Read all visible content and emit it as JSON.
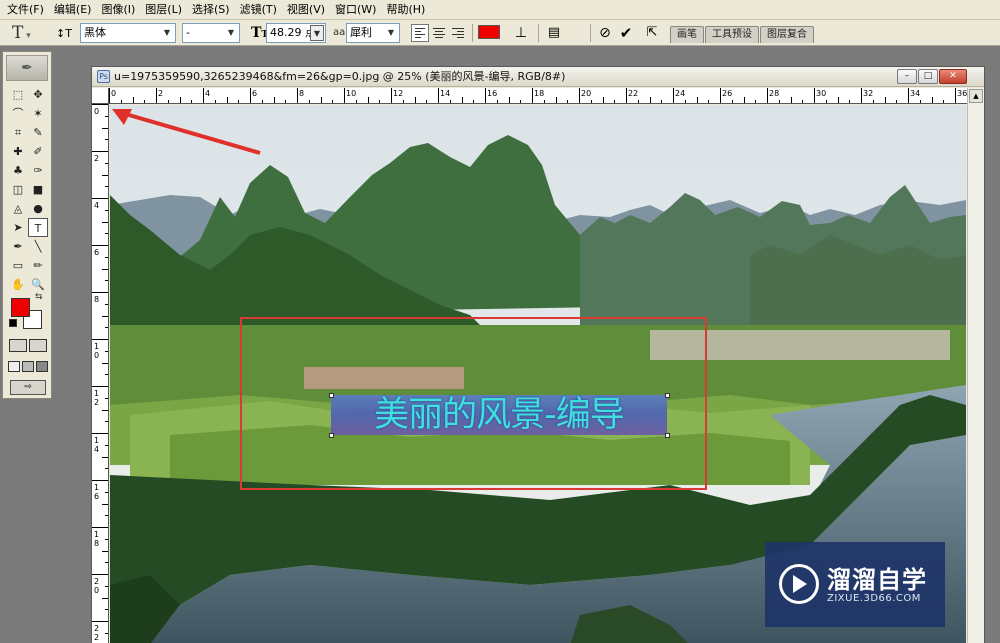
{
  "menubar": {
    "items": [
      "文件(F)",
      "编辑(E)",
      "图像(I)",
      "图层(L)",
      "选择(S)",
      "滤镜(T)",
      "视图(V)",
      "窗口(W)",
      "帮助(H)"
    ]
  },
  "options": {
    "tool_icon": "T",
    "orient_icon": "↕T",
    "font_family": "黑体",
    "font_style": "-",
    "size_icon": "T",
    "font_size": "48.29 点",
    "aa_icon": "aa",
    "antialias": "犀利",
    "text_color": "#ee0000",
    "warp_icon": "⊥",
    "palettes_icon": "▤",
    "cancel_icon": "⊘",
    "commit_icon": "✔",
    "bridge_icon": "⇱",
    "well_tabs": [
      "画笔",
      "工具预设",
      "图层复合"
    ]
  },
  "toolbox": {
    "tools": [
      "⬚",
      "✥",
      "⌒",
      "✶",
      "⌗",
      "✎",
      "✚",
      "✐",
      "♣",
      "✑",
      "◫",
      "■",
      "◬",
      "●",
      "➤",
      "T",
      "✒",
      "╲",
      "▭",
      "✏",
      "✋",
      "🔍"
    ],
    "foreground": "#ee0000",
    "background": "#ffffff",
    "swap_icon": "⇆"
  },
  "document": {
    "title": "u=1975359590,3265239468&fm=26&gp=0.jpg @ 25% (美丽的风景-编导, RGB/8#)",
    "min_icon": "–",
    "max_icon": "□",
    "close_icon": "✕",
    "ruler_h": [
      "0",
      "2",
      "4",
      "6",
      "8",
      "10",
      "12",
      "14",
      "16",
      "18",
      "20",
      "22",
      "24",
      "26",
      "28",
      "30",
      "32",
      "34",
      "36"
    ],
    "ruler_v": [
      "0",
      "2",
      "4",
      "6",
      "8",
      "1\n0",
      "1\n2",
      "1\n4",
      "1\n6",
      "1\n8",
      "2\n0",
      "2\n2"
    ],
    "text_layer": "美丽的风景-编导"
  },
  "watermark": {
    "brand": "溜溜自学",
    "url": "ZIXUE.3D66.COM"
  }
}
